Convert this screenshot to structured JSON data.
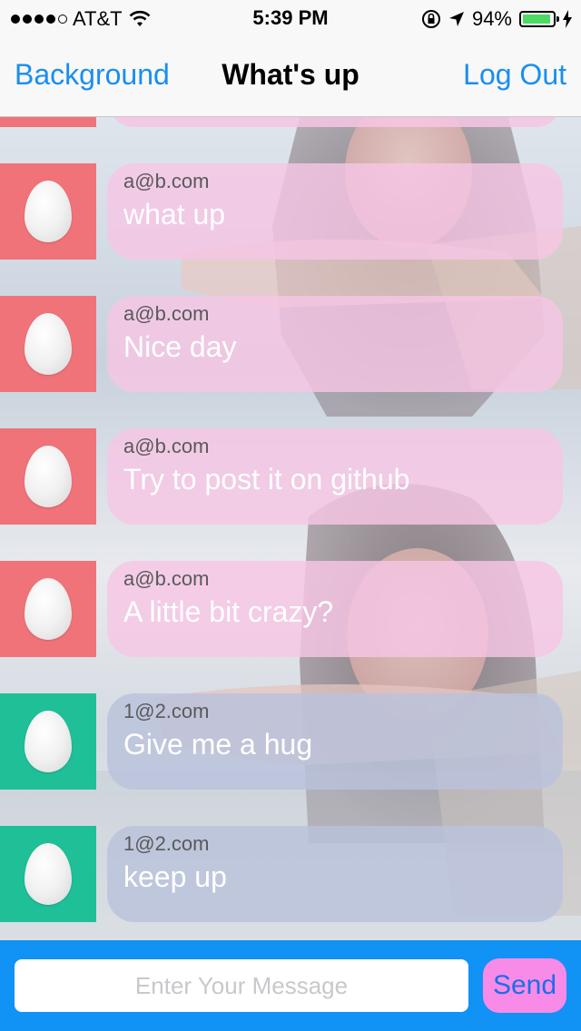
{
  "status_bar": {
    "carrier": "AT&T",
    "time": "5:39 PM",
    "battery_percent": "94%",
    "battery_level": 0.94,
    "icons": [
      "signal-dots-icon",
      "wifi-icon",
      "rotation-lock-icon",
      "location-arrow-icon",
      "battery-icon",
      "charging-bolt-icon"
    ]
  },
  "nav": {
    "left_label": "Background",
    "title": "What's up",
    "right_label": "Log Out"
  },
  "messages": [
    {
      "sender": "a@b.com",
      "text": "what up",
      "avatar_color": "#f0737a",
      "bubble_color": "#f6c6e4"
    },
    {
      "sender": "a@b.com",
      "text": "Nice day",
      "avatar_color": "#f0737a",
      "bubble_color": "#f6c6e4"
    },
    {
      "sender": "a@b.com",
      "text": "Try to post it on github",
      "avatar_color": "#f0737a",
      "bubble_color": "#f6c6e4"
    },
    {
      "sender": "a@b.com",
      "text": "A little bit crazy?",
      "avatar_color": "#f0737a",
      "bubble_color": "#f6c6e4"
    },
    {
      "sender": "1@2.com",
      "text": "Give me a hug",
      "avatar_color": "#1fbf98",
      "bubble_color": "#b9c2dc"
    },
    {
      "sender": "1@2.com",
      "text": "keep up",
      "avatar_color": "#1fbf98",
      "bubble_color": "#b9c2dc"
    }
  ],
  "input": {
    "placeholder": "Enter Your Message",
    "value": "",
    "send_label": "Send"
  },
  "colors": {
    "accent": "#1a8ef0",
    "input_bar": "#1192f5",
    "send_button": "#f88be8",
    "sent_avatar": "#f0737a",
    "received_avatar": "#1fbf98"
  }
}
